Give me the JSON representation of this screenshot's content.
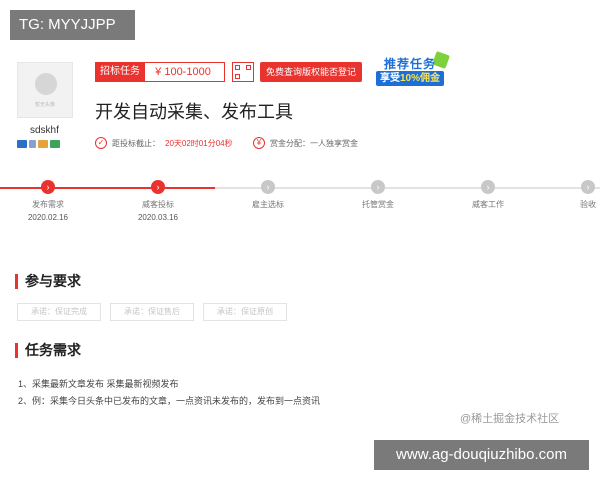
{
  "badge": {
    "text": "TG: MYYJJPP"
  },
  "user": {
    "avatar_caption": "暂无头像",
    "name": "sdskhf",
    "icons": [
      "id-card-icon",
      "phone-icon",
      "email-icon",
      "bank-card-icon"
    ],
    "icon_colors": [
      "#2a6fc9",
      "#8aa0c8",
      "#e6a23c",
      "#3aa55a"
    ]
  },
  "task": {
    "tag": "招标任务",
    "price": "¥ 100-1000",
    "free_button": "免费查询版权能否登记",
    "promo_line1": "推荐任务",
    "promo_line2_prefix": "享受",
    "promo_line2_highlight": "10%佣金",
    "title": "开发自动采集、发布工具",
    "deadline_label": "距投标截止：",
    "deadline_value": "20天02时01分04秒",
    "reward_label": "赏金分配：一人独享赏金"
  },
  "steps": [
    {
      "label": "发布需求",
      "date": "2020.02.16",
      "active": true
    },
    {
      "label": "威客投标",
      "date": "2020.03.16",
      "active": true
    },
    {
      "label": "雇主选标",
      "date": "",
      "active": false
    },
    {
      "label": "托管赏金",
      "date": "",
      "active": false
    },
    {
      "label": "威客工作",
      "date": "",
      "active": false
    },
    {
      "label": "验收",
      "date": "",
      "active": false
    }
  ],
  "sections": {
    "participation_title": "参与要求",
    "chips": [
      "承诺：保证完成",
      "承诺：保证售后",
      "承诺：保证原创"
    ],
    "requirements_title": "任务需求",
    "lines": [
      "1、采集最新文章发布 采集最新视频发布",
      "2、例：采集今日头条中已发布的文章，一点资讯未发布的，发布到一点资讯"
    ]
  },
  "watermark": "@稀土掘金技术社区",
  "url_badge": "www.ag-douqiuzhibo.com",
  "colors": {
    "accent": "#e8332f",
    "promo_blue": "#1c6fd6",
    "inactive": "#c8c8c8"
  }
}
